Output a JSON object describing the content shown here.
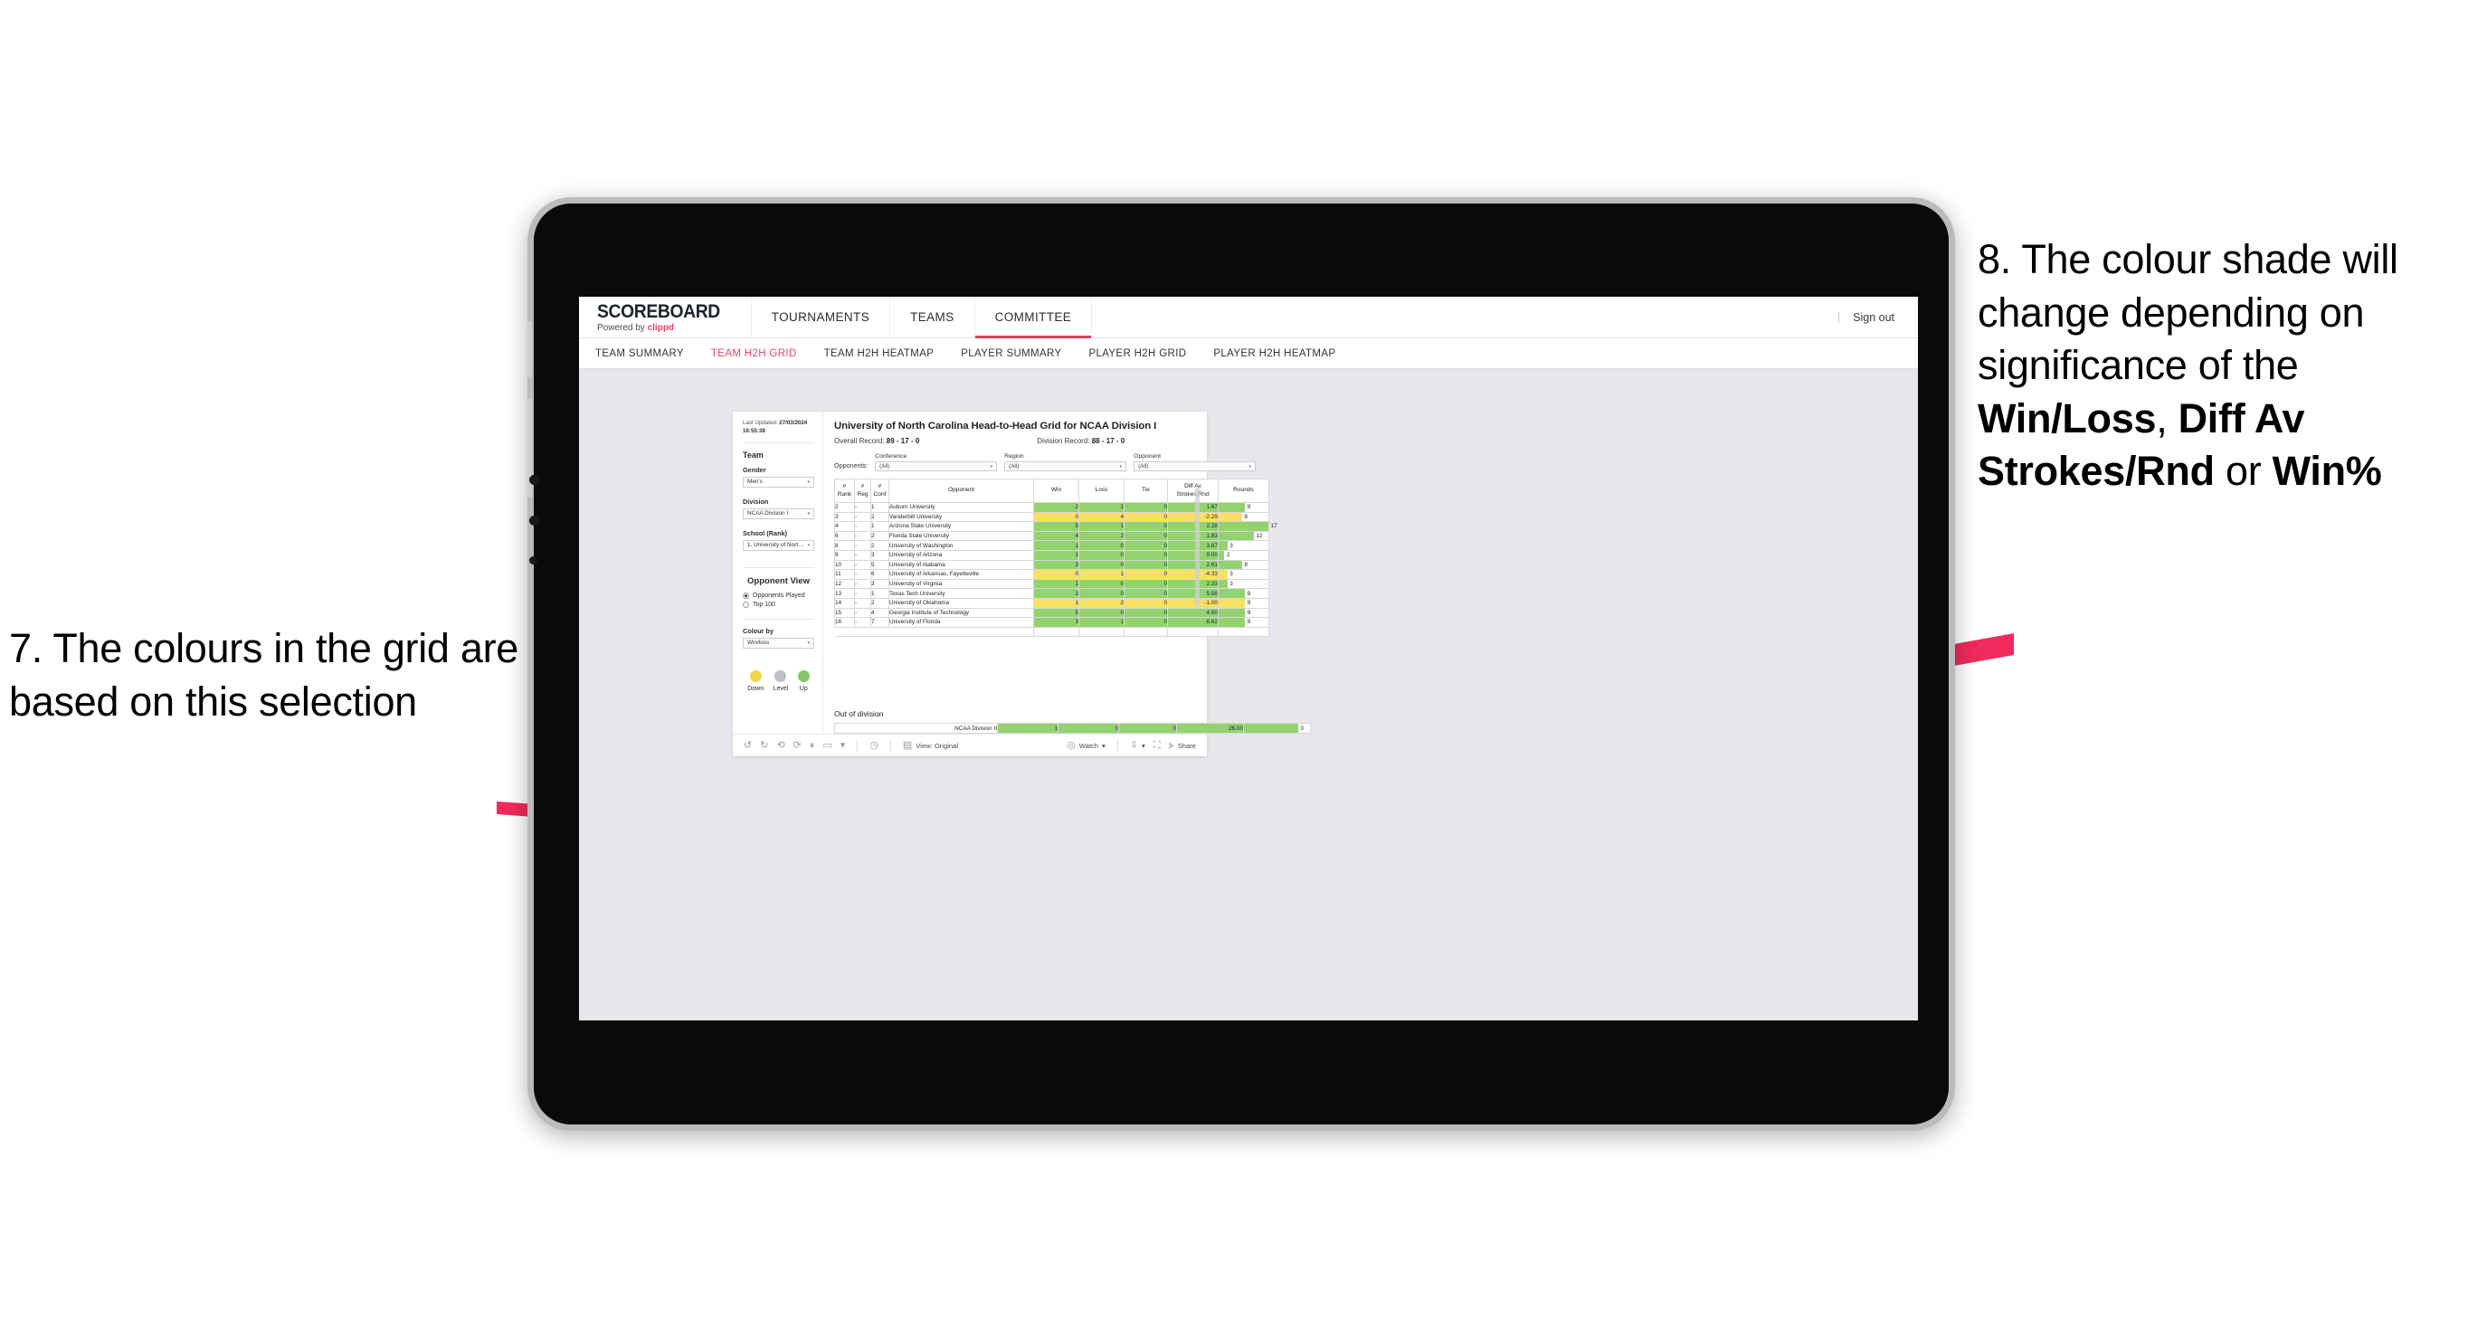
{
  "annotations": {
    "left": "7. The colours in the grid are based on this selection",
    "right_parts": [
      {
        "t": "8. The colour shade will change depending on significance of the ",
        "b": false
      },
      {
        "t": "Win/Loss",
        "b": true
      },
      {
        "t": ", ",
        "b": false
      },
      {
        "t": "Diff Av Strokes/Rnd",
        "b": true
      },
      {
        "t": " or ",
        "b": false
      },
      {
        "t": "Win%",
        "b": true
      }
    ],
    "arrow_color": "#F02B5B"
  },
  "header": {
    "logo_main": "SCOREBOARD",
    "logo_powered": "Powered by ",
    "logo_brand": "clippd",
    "nav": [
      {
        "label": "TOURNAMENTS",
        "active": false
      },
      {
        "label": "TEAMS",
        "active": false
      },
      {
        "label": "COMMITTEE",
        "active": true
      }
    ],
    "divider": "|",
    "sign_out": "Sign out"
  },
  "subnav": [
    {
      "label": "TEAM SUMMARY",
      "active": false
    },
    {
      "label": "TEAM H2H GRID",
      "active": true
    },
    {
      "label": "TEAM H2H HEATMAP",
      "active": false
    },
    {
      "label": "PLAYER SUMMARY",
      "active": false
    },
    {
      "label": "PLAYER H2H GRID",
      "active": false
    },
    {
      "label": "PLAYER H2H HEATMAP",
      "active": false
    }
  ],
  "sidebar": {
    "updated_label": "Last Updated: ",
    "updated_date": "27/03/2024",
    "updated_time": "16:55:38",
    "team_title": "Team",
    "gender_label": "Gender",
    "gender_value": "Men's",
    "division_label": "Division",
    "division_value": "NCAA Division I",
    "school_label": "School (Rank)",
    "school_value": "1. University of Nort…",
    "opponent_view_title": "Opponent View",
    "opponent_options": [
      {
        "label": "Opponents Played",
        "selected": true
      },
      {
        "label": "Top 100",
        "selected": false
      }
    ],
    "colour_by_label": "Colour by",
    "colour_by_value": "Win/loss",
    "legend": [
      {
        "label": "Down",
        "color": "#F4D44E"
      },
      {
        "label": "Level",
        "color": "#BFBFC6"
      },
      {
        "label": "Up",
        "color": "#84C967"
      }
    ]
  },
  "main": {
    "title": "University of North Carolina Head-to-Head Grid for NCAA Division I",
    "overall_label": "Overall Record: ",
    "overall_value": "89 - 17 - 0",
    "division_label": "Division Record: ",
    "division_value": "88 - 17 - 0",
    "opponents_label": "Opponents:",
    "filters": [
      {
        "label": "Conference",
        "value": "(All)"
      },
      {
        "label": "Region",
        "value": "(All)"
      },
      {
        "label": "Opponent",
        "value": "(All)"
      }
    ]
  },
  "table": {
    "headers": [
      "#\nRank",
      "#\nReg",
      "#\nConf",
      "Opponent",
      "Win",
      "Loss",
      "Tie",
      "Diff Av\nStrokes/Rnd",
      "Rounds"
    ],
    "headers_flat": {
      "rank_l1": "#",
      "rank_l2": "Rank",
      "reg_l1": "#",
      "reg_l2": "Reg",
      "conf_l1": "#",
      "conf_l2": "Conf",
      "opponent": "Opponent",
      "win": "Win",
      "loss": "Loss",
      "tie": "Tie",
      "diff_l1": "Diff Av",
      "diff_l2": "Strokes/Rnd",
      "rounds": "Rounds"
    },
    "rounds_max": 17,
    "rows": [
      {
        "rank": "2",
        "reg": "-",
        "conf": "1",
        "opponent": "Auburn University",
        "win": "2",
        "loss": "1",
        "tie": "0",
        "diff": "1.67",
        "rounds": "9",
        "state": "up"
      },
      {
        "rank": "3",
        "reg": "-",
        "conf": "2",
        "opponent": "Vanderbilt University",
        "win": "0",
        "loss": "4",
        "tie": "0",
        "diff": "-2.29",
        "rounds": "8",
        "state": "down"
      },
      {
        "rank": "4",
        "reg": "-",
        "conf": "1",
        "opponent": "Arizona State University",
        "win": "5",
        "loss": "1",
        "tie": "0",
        "diff": "2.28",
        "rounds": "17",
        "state": "up"
      },
      {
        "rank": "6",
        "reg": "-",
        "conf": "2",
        "opponent": "Florida State University",
        "win": "4",
        "loss": "2",
        "tie": "0",
        "diff": "1.83",
        "rounds": "12",
        "state": "up"
      },
      {
        "rank": "8",
        "reg": "-",
        "conf": "2",
        "opponent": "University of Washington",
        "win": "1",
        "loss": "0",
        "tie": "0",
        "diff": "3.67",
        "rounds": "3",
        "state": "up"
      },
      {
        "rank": "9",
        "reg": "-",
        "conf": "3",
        "opponent": "University of Arizona",
        "win": "1",
        "loss": "0",
        "tie": "0",
        "diff": "9.00",
        "rounds": "2",
        "state": "up"
      },
      {
        "rank": "10",
        "reg": "-",
        "conf": "5",
        "opponent": "University of Alabama",
        "win": "3",
        "loss": "0",
        "tie": "0",
        "diff": "2.61",
        "rounds": "8",
        "state": "up"
      },
      {
        "rank": "11",
        "reg": "-",
        "conf": "6",
        "opponent": "University of Arkansas, Fayetteville",
        "win": "0",
        "loss": "1",
        "tie": "0",
        "diff": "-4.33",
        "rounds": "3",
        "state": "down"
      },
      {
        "rank": "12",
        "reg": "-",
        "conf": "3",
        "opponent": "University of Virginia",
        "win": "1",
        "loss": "0",
        "tie": "0",
        "diff": "2.33",
        "rounds": "3",
        "state": "up"
      },
      {
        "rank": "13",
        "reg": "-",
        "conf": "1",
        "opponent": "Texas Tech University",
        "win": "3",
        "loss": "0",
        "tie": "0",
        "diff": "5.56",
        "rounds": "9",
        "state": "up"
      },
      {
        "rank": "14",
        "reg": "-",
        "conf": "2",
        "opponent": "University of Oklahoma",
        "win": "1",
        "loss": "2",
        "tie": "0",
        "diff": "-1.00",
        "rounds": "9",
        "state": "down"
      },
      {
        "rank": "15",
        "reg": "-",
        "conf": "4",
        "opponent": "Georgia Institute of Technology",
        "win": "5",
        "loss": "0",
        "tie": "0",
        "diff": "4.50",
        "rounds": "9",
        "state": "up"
      },
      {
        "rank": "16",
        "reg": "-",
        "conf": "7",
        "opponent": "University of Florida",
        "win": "3",
        "loss": "1",
        "tie": "0",
        "diff": "6.62",
        "rounds": "9",
        "state": "up"
      }
    ],
    "colors": {
      "up": "#92D36E",
      "down": "#F8E063"
    }
  },
  "out_of_division": {
    "title": "Out of division",
    "row": {
      "label": "NCAA Division II",
      "win": "1",
      "loss": "0",
      "tie": "0",
      "diff": "26.00",
      "rounds": "3",
      "state": "up"
    }
  },
  "toolbar": {
    "undo": "↺",
    "redo": "↻",
    "revert": "⟲",
    "refresh": "⟳",
    "pause": "⏸",
    "shape": "▭",
    "caret": "▾",
    "help": "◷",
    "view_label": "View: Original",
    "watch_label": "Watch",
    "watch_caret": "▾",
    "device_caret": "▾",
    "share_label": "Share"
  }
}
